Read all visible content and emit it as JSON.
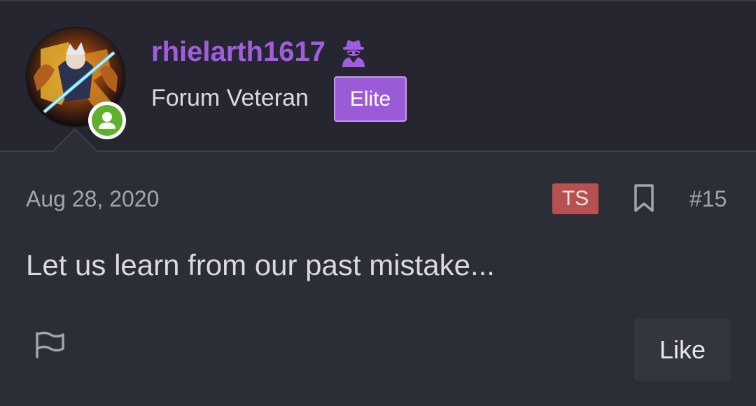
{
  "post": {
    "author": {
      "username": "rhielarth1617",
      "user_title": "Forum Veteran",
      "badge": "Elite",
      "online": true,
      "username_color": "#a25ce0",
      "badge_color": "#9b5ad6",
      "status_icon": "user-secret-icon",
      "online_icon": "user-icon"
    },
    "date": "Aug 28, 2020",
    "thread_starter_badge": "TS",
    "ts_badge_color": "#b85050",
    "number": "#15",
    "body": "Let us learn from our past mistake...",
    "actions": {
      "report_icon": "flag-icon",
      "bookmark_icon": "bookmark-icon",
      "like_label": "Like"
    }
  },
  "colors": {
    "background": "#2b2d37",
    "header_background": "#25262f",
    "online_green": "#5fb02c"
  }
}
